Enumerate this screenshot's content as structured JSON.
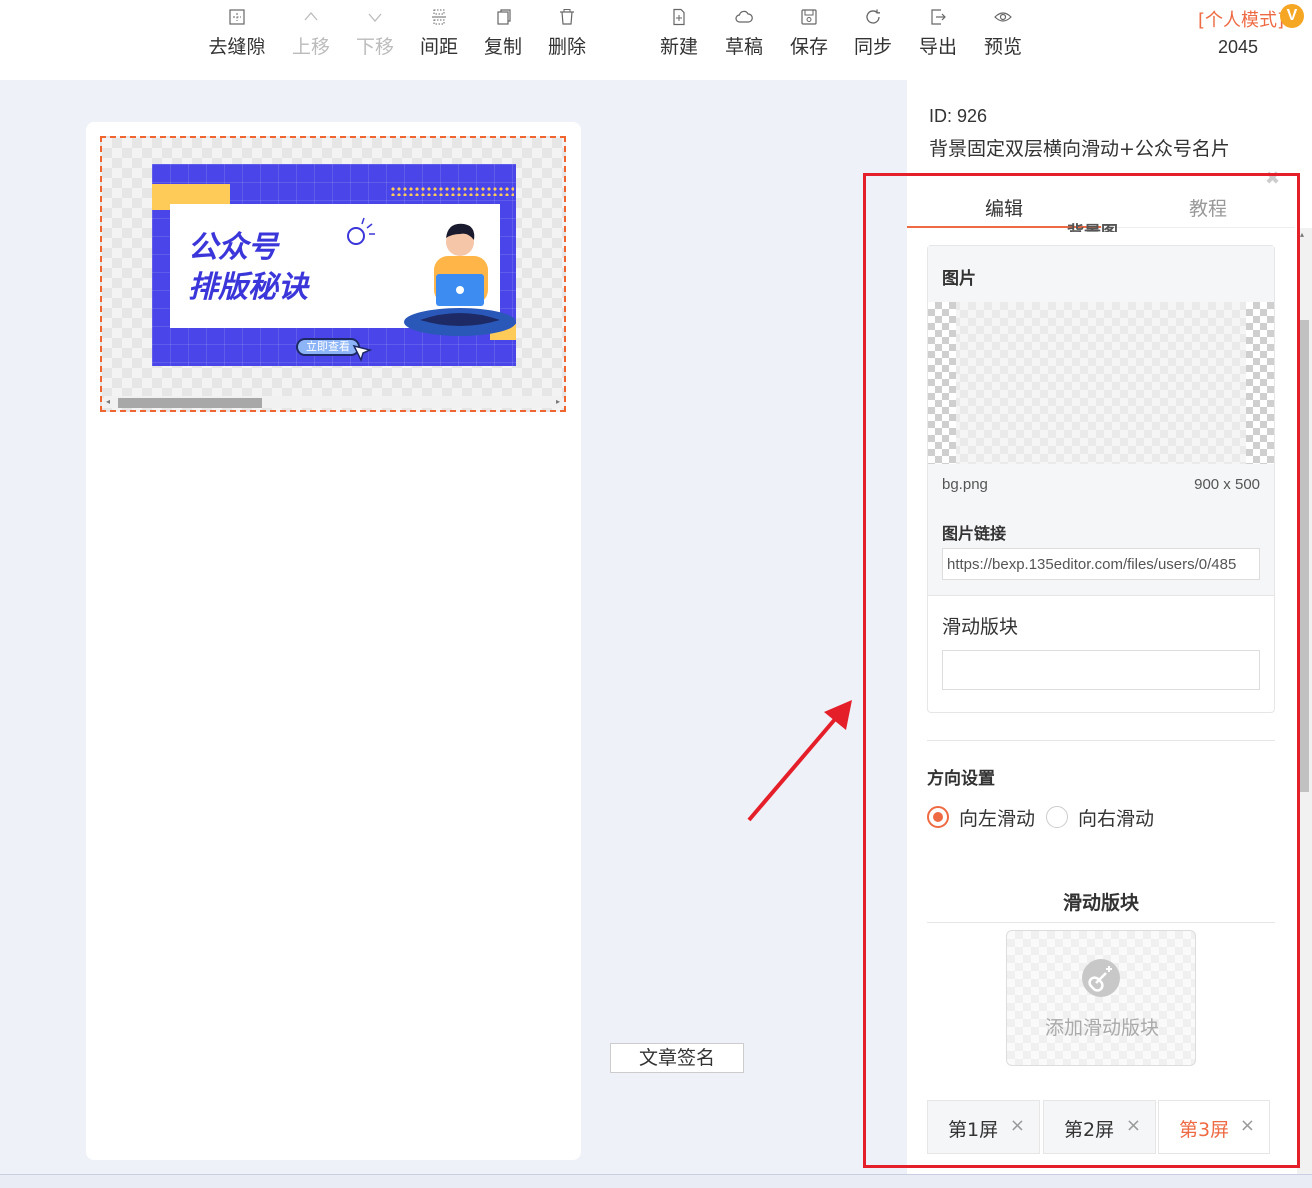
{
  "toolbar": {
    "left_tools": [
      {
        "name": "remove-gap",
        "label": "去缝隙",
        "icon": "grid-icon",
        "disabled": false
      },
      {
        "name": "move-up",
        "label": "上移",
        "icon": "chevron-up-icon",
        "disabled": true
      },
      {
        "name": "move-down",
        "label": "下移",
        "icon": "chevron-down-icon",
        "disabled": true
      },
      {
        "name": "spacing",
        "label": "间距",
        "icon": "spacing-icon",
        "disabled": false
      },
      {
        "name": "copy",
        "label": "复制",
        "icon": "copy-icon",
        "disabled": false
      },
      {
        "name": "delete",
        "label": "删除",
        "icon": "trash-icon",
        "disabled": false
      }
    ],
    "right_tools": [
      {
        "name": "new",
        "label": "新建",
        "icon": "new-file-icon"
      },
      {
        "name": "draft",
        "label": "草稿",
        "icon": "cloud-icon"
      },
      {
        "name": "save",
        "label": "保存",
        "icon": "save-icon"
      },
      {
        "name": "sync",
        "label": "同步",
        "icon": "sync-icon"
      },
      {
        "name": "export",
        "label": "导出",
        "icon": "export-icon"
      },
      {
        "name": "preview",
        "label": "预览",
        "icon": "eye-icon"
      }
    ],
    "mode": "[个人模式]",
    "vip_badge": "V",
    "count": "2045"
  },
  "banner": {
    "line1": "公众号",
    "line2": "排版秘诀",
    "button": "立即查看"
  },
  "sign_button": "文章签名",
  "panel": {
    "id": "ID: 926",
    "name": "背景固定双层横向滑动+公众号名片",
    "tabs": [
      "编辑",
      "教程"
    ],
    "cut_title": "背景图",
    "image_label": "图片",
    "file_name": "bg.png",
    "file_size": "900 x 500",
    "link_label": "图片链接",
    "link_value": "https://bexp.135editor.com/files/users/0/485",
    "slide_label": "滑动版块",
    "direction_label": "方向设置",
    "directions": [
      "向左滑动",
      "向右滑动"
    ],
    "selected_direction": 0,
    "slide_section_title": "滑动版块",
    "add_slide": "添加滑动版块",
    "screens": [
      "第1屏",
      "第2屏",
      "第3屏"
    ],
    "active_screen": 2
  },
  "colors": {
    "accent": "#ee6a43",
    "annotation": "#e51f2a",
    "banner_blue": "#4a45e8",
    "banner_yellow": "#ffcb58"
  }
}
